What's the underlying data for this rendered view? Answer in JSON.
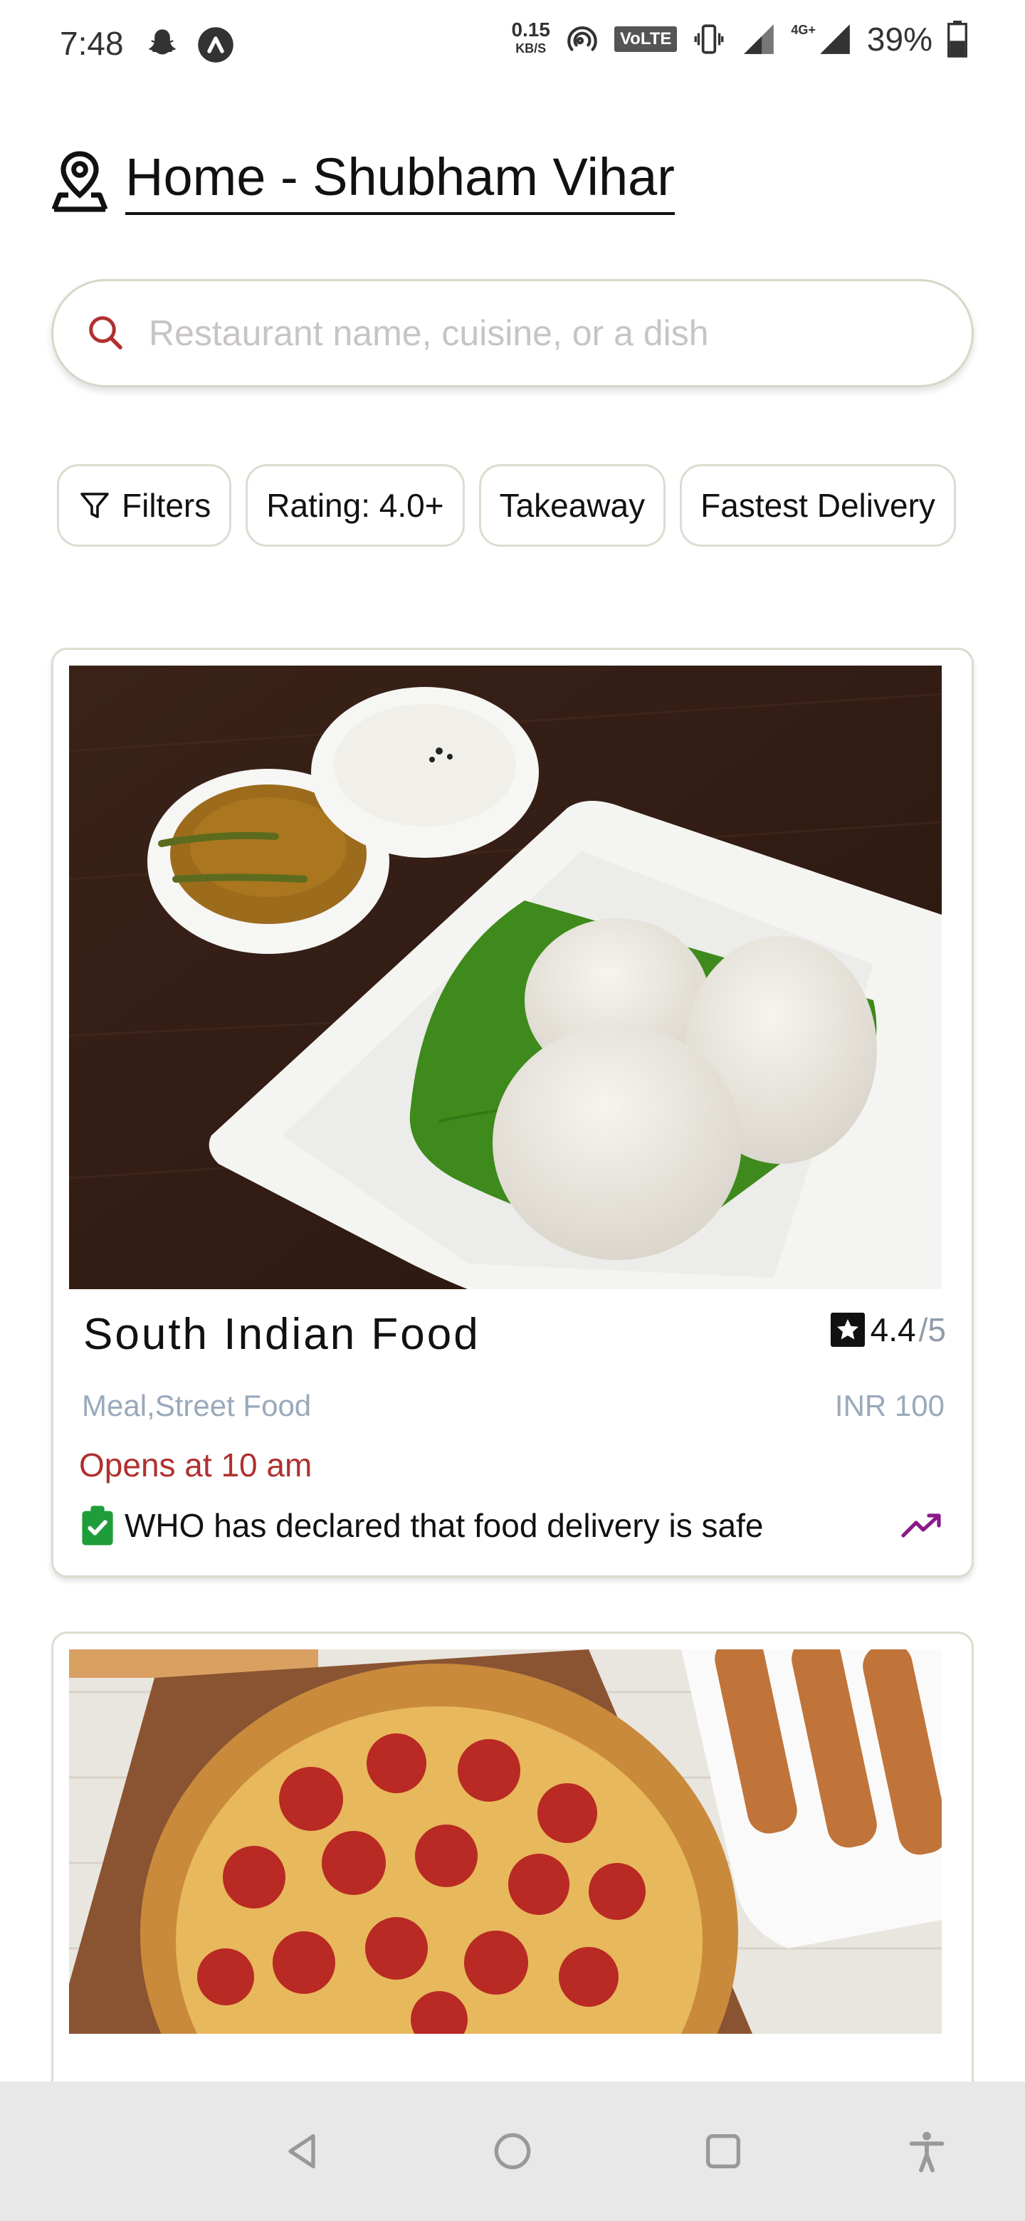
{
  "status_bar": {
    "time": "7:48",
    "speed_value": "0.15",
    "speed_unit": "KB/S",
    "volte": "VoLTE",
    "network": "4G+",
    "battery": "39%"
  },
  "header": {
    "location": "Home - Shubham Vihar"
  },
  "search": {
    "placeholder": "Restaurant name, cuisine, or a dish"
  },
  "filters": [
    {
      "label": "Filters",
      "icon": "filter-icon"
    },
    {
      "label": "Rating: 4.0+"
    },
    {
      "label": "Takeaway"
    },
    {
      "label": "Fastest Delivery"
    }
  ],
  "restaurants": [
    {
      "name": "South Indian Food",
      "rating": "4.4",
      "rating_max": "/5",
      "categories": "Meal,Street Food",
      "price": "INR 100",
      "status": "Opens at 10 am",
      "safety_note": "WHO has declared that food delivery is safe"
    }
  ],
  "colors": {
    "accent_red": "#b03030",
    "muted_blue": "#9aa9bb",
    "safety_green": "#1f9d3a",
    "trend_purple": "#8a1a8a"
  }
}
